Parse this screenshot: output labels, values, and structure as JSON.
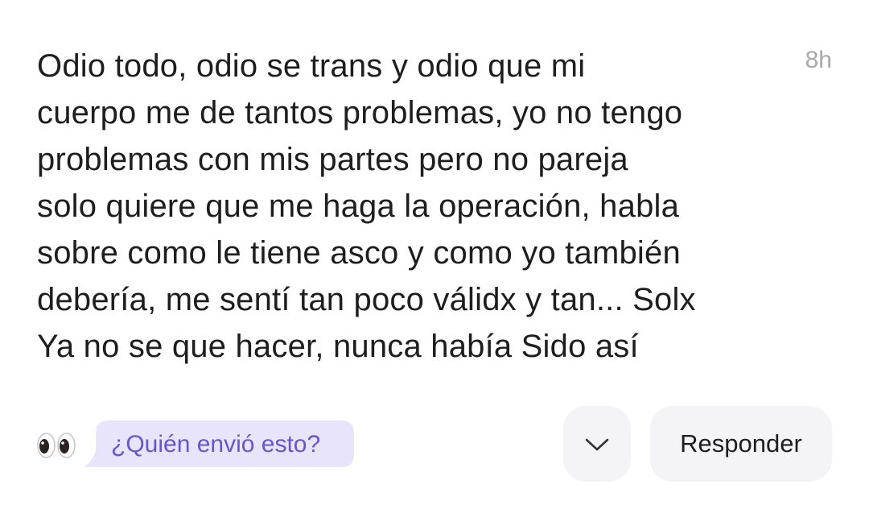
{
  "message": {
    "lines": [
      "Odio todo, odio se trans y odio que mi",
      "cuerpo me de tantos problemas, yo no tengo",
      "problemas con mis partes pero no pareja",
      "solo quiere que me haga la operación, habla",
      "sobre como le tiene asco y como yo también",
      "debería, me sentí tan poco válidx y tan... Solx",
      "Ya no se que hacer, nunca había Sido así"
    ],
    "time": "8h"
  },
  "footer": {
    "reaction_icon": "eyes-icon",
    "who_sent_label": "¿Quién envió esto?",
    "expand_icon": "chevron-down-icon",
    "reply_label": "Responder"
  },
  "colors": {
    "who_sent_bg": "#e8e4fb",
    "who_sent_text": "#6a55c8",
    "button_bg": "#f4f4f6",
    "timestamp": "#a9a9a9"
  }
}
